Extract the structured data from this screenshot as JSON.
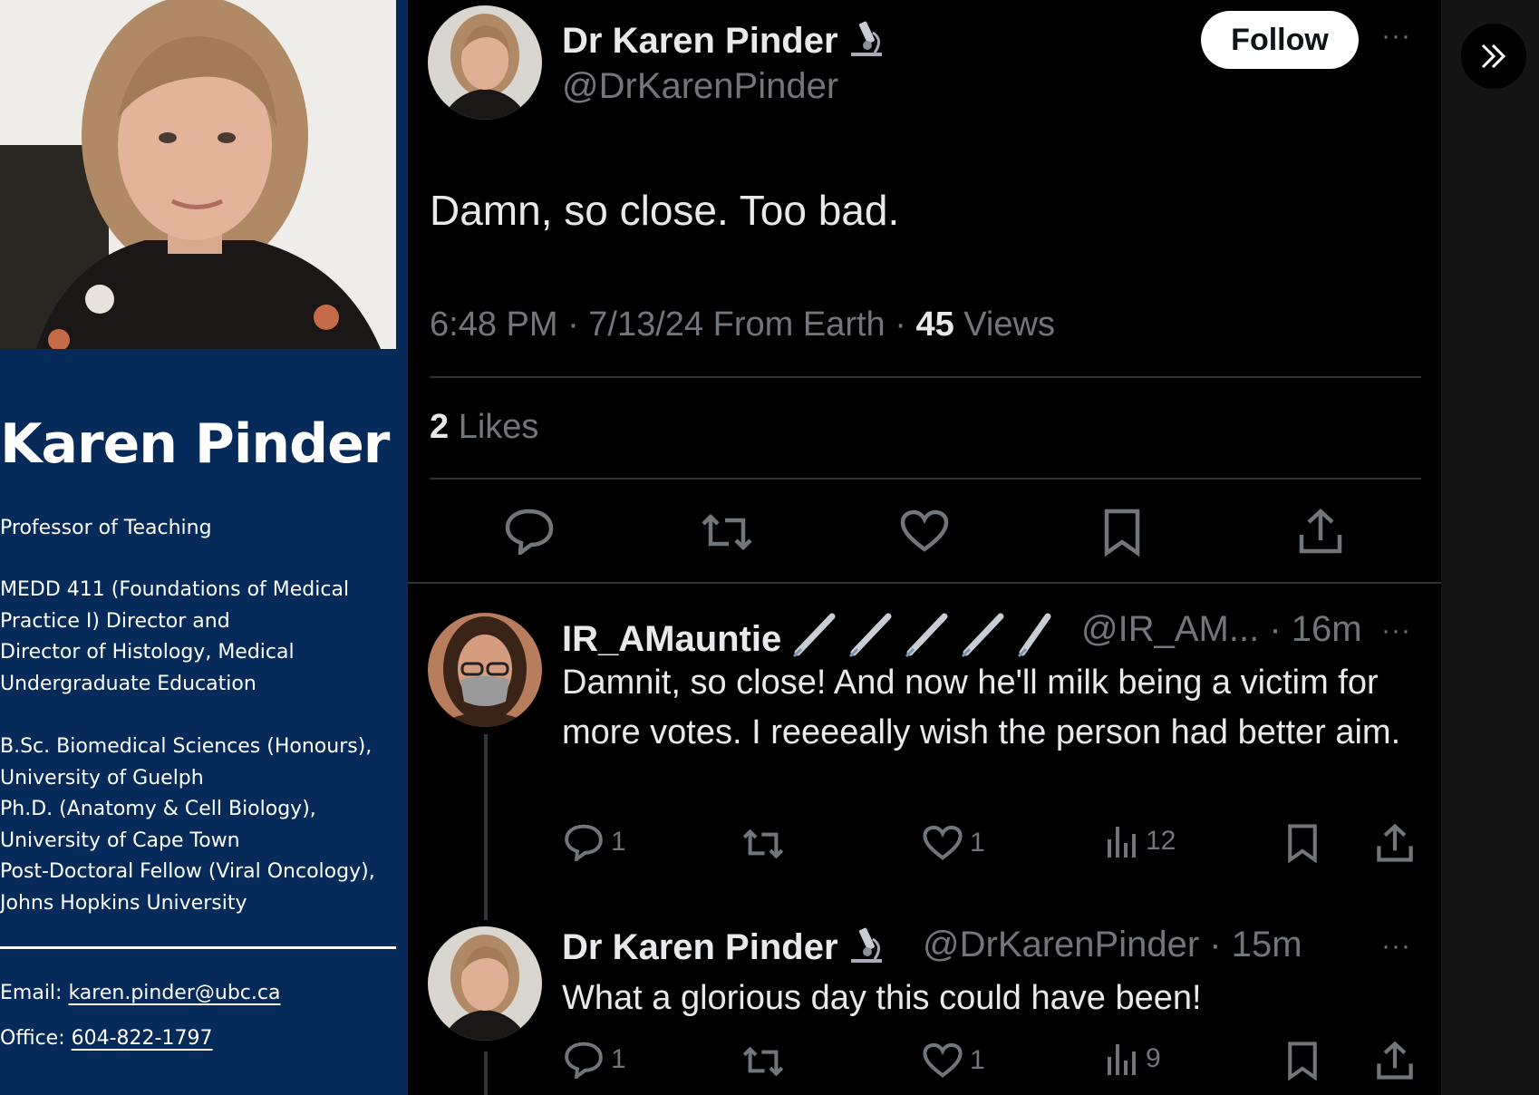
{
  "profile": {
    "name": "Karen Pinder",
    "title": "Professor of Teaching",
    "roles": [
      "MEDD 411 (Foundations of Medical",
      "Practice I) Director and",
      "Director of Histology, Medical",
      "Undergraduate Education"
    ],
    "education": [
      "B.Sc. Biomedical Sciences (Honours),",
      "University of Guelph",
      "Ph.D. (Anatomy & Cell Biology),",
      "University of Cape Town",
      "Post-Doctoral Fellow (Viral Oncology),",
      "Johns Hopkins University"
    ],
    "email_label": "Email: ",
    "email": "karen.pinder@ubc.ca",
    "office_label": "Office: ",
    "office": "604-822-1797"
  },
  "main_tweet": {
    "author_name": "Dr Karen Pinder",
    "author_handle": "@DrKarenPinder",
    "follow_label": "Follow",
    "more": "···",
    "text": "Damn, so close. Too bad.",
    "meta_prefix": "6:48 PM · 7/13/24 From Earth · ",
    "views_count": "45",
    "views_label": " Views",
    "likes_count": "2",
    "likes_label": " Likes"
  },
  "replies": [
    {
      "author_name": "IR_AMauntie",
      "author_handle": "@IR_AM...",
      "time": " · 16m",
      "more": "···",
      "text": "Damnit, so close! And now he'll milk being a victim for more votes. I reeeeally wish the person had better aim.",
      "replies": "1",
      "likes": "1",
      "views": "12"
    },
    {
      "author_name": "Dr Karen Pinder",
      "author_handle": "@DrKarenPinder",
      "time": " · 15m",
      "more": "···",
      "text": "What a glorious day this could have been!",
      "replies": "1",
      "likes": "1",
      "views": "9"
    }
  ],
  "icons": [
    "microscope-icon",
    "syringe-icon",
    "reply-icon",
    "retweet-icon",
    "heart-icon",
    "bookmark-icon",
    "share-icon",
    "views-icon",
    "double-chevron-right-icon"
  ],
  "colors": {
    "panel_blue": "#062a5a",
    "background": "#000000",
    "muted_text": "#71767b",
    "primary_text": "#e7e9ea"
  }
}
